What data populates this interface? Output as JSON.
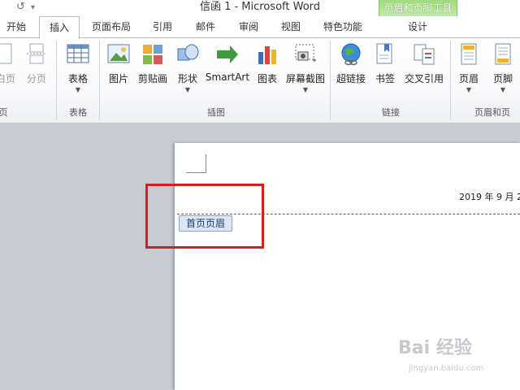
{
  "window": {
    "title": "信函 1 - Microsoft Word",
    "quick_access": [
      "↺",
      "▾"
    ],
    "context_group": "页眉和页脚工具"
  },
  "tabs": [
    {
      "label": "开始",
      "active": false
    },
    {
      "label": "插入",
      "active": true
    },
    {
      "label": "页面布局",
      "active": false
    },
    {
      "label": "引用",
      "active": false
    },
    {
      "label": "邮件",
      "active": false
    },
    {
      "label": "审阅",
      "active": false
    },
    {
      "label": "视图",
      "active": false
    },
    {
      "label": "特色功能",
      "active": false
    },
    {
      "label": "设计",
      "active": false
    }
  ],
  "ribbon": {
    "pages": {
      "group_label": "页",
      "items": [
        "白页",
        "分页"
      ]
    },
    "tables": {
      "group_label": "表格",
      "items": [
        "表格"
      ]
    },
    "illustrations": {
      "group_label": "插图",
      "items": [
        "图片",
        "剪贴画",
        "形状",
        "SmartArt",
        "图表",
        "屏幕截图"
      ]
    },
    "links": {
      "group_label": "链接",
      "items": [
        "超链接",
        "书签",
        "交叉引用"
      ]
    },
    "header_footer": {
      "group_label": "页眉和页",
      "items": [
        "页眉",
        "页脚"
      ]
    }
  },
  "document": {
    "header_date": "2019 年 9 月 2",
    "header_tag": "首页页眉"
  },
  "watermark": {
    "text": "Bai 经验",
    "sub": "jingyan.baidu.com"
  }
}
